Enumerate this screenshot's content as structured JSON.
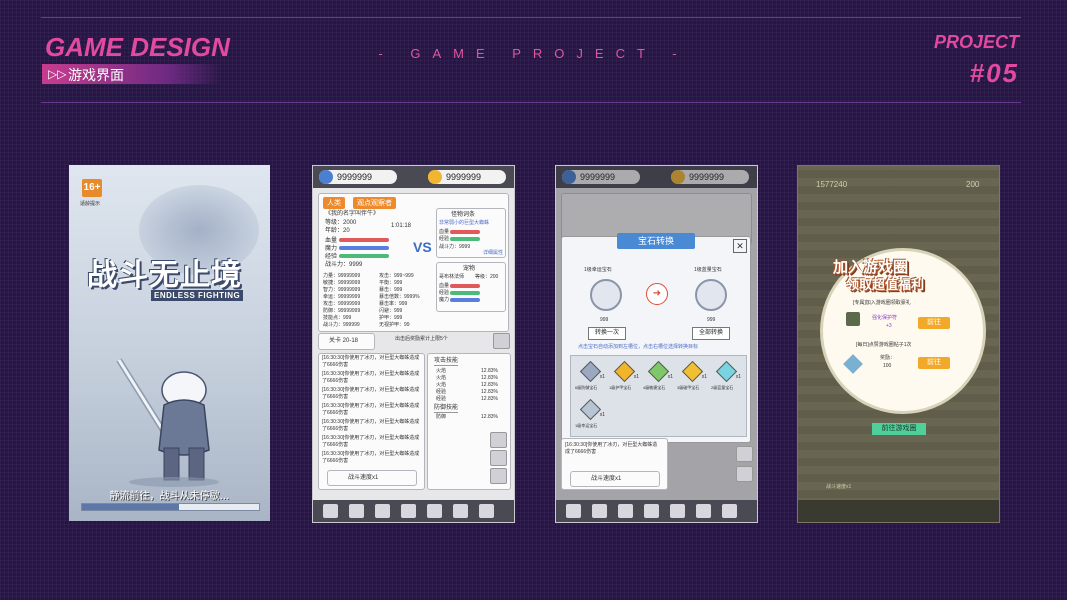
{
  "header": {
    "title": "GAME DESIGN",
    "subtitle": "游戏界面",
    "center_label": "- GAME PROJECT -",
    "project_label": "PROJECT",
    "project_number": "#05"
  },
  "screen1": {
    "age_rating": "16+",
    "age_text": "适龄提示",
    "logo_cn": "战斗无止境",
    "logo_en": "ENDLESS FIGHTING",
    "loading_text": "静流前往，战斗从未停歇…",
    "progress": 0.55
  },
  "screen2": {
    "currency1": "9999999",
    "currency2": "9999999",
    "tab_race": "人类",
    "tab_observer": "观点观察者",
    "player_name": "《我的名字叫伴牛》",
    "level_label": "等级：2000",
    "age_label": "年龄：20",
    "timer": "1:01:18",
    "stat_hp": "血量",
    "stat_mp": "魔力",
    "stat_exp": "经验",
    "combat_label": "战斗力：9999",
    "vs": "VS",
    "monster_title": "怪物词条",
    "monster_name": "非常弱小的巨型大蜘蛛",
    "detail_link": "详细属性",
    "pet_title": "宠物",
    "pet_name": "哥布林法师",
    "pet_level": "等级：200",
    "attrs_left": [
      "力量：99999999",
      "敏捷：99999999",
      "智力：99999999",
      "幸运：99999999",
      "攻击：99999999",
      "防御：99999999",
      "技能点：999",
      "战斗力：999999"
    ],
    "attrs_right": [
      "攻击：999~999",
      "平衡：999",
      "暴击：999",
      "暴击倍数：9999%",
      "暴击率：999",
      "闪避：999",
      "护甲：999",
      "无视护甲：99"
    ],
    "stage": "关卡 20-18",
    "stage_note": "出击后奖励累计上限5个",
    "logs": [
      "[16:30:30]你使用了冰刃，对巨型大蜘蛛造成了6666伤害",
      "[16:30:30]你使用了冰刃，对巨型大蜘蛛造成了6666伤害",
      "[16:30:30]你使用了冰刃，对巨型大蜘蛛造成了6666伤害",
      "[16:30:30]你使用了冰刃，对巨型大蜘蛛造成了6666伤害",
      "[16:30:30]你使用了冰刃，对巨型大蜘蛛造成了6666伤害",
      "[16:30:30]你使用了冰刃，对巨型大蜘蛛造成了6666伤害",
      "[16:30:30]你使用了冰刃，对巨型大蜘蛛造成了6666伤害"
    ],
    "attack_skill": "攻击技能",
    "attack_rows": [
      [
        "火焰",
        "12.83%"
      ],
      [
        "火焰",
        "12.83%"
      ],
      [
        "火焰",
        "12.83%"
      ],
      [
        "经验",
        "12.83%"
      ],
      [
        "经验",
        "12.83%"
      ]
    ],
    "defense_skill": "防御技能",
    "defense_rows": [
      [
        "防御",
        "12.83%"
      ]
    ],
    "speed": "战斗速度x1"
  },
  "screen3": {
    "currency1": "9999999",
    "currency2": "9999999",
    "modal_title": "宝石转换",
    "left_gem": "1级幸运宝石",
    "right_gem": "1级蓝量宝石",
    "cost": "999",
    "convert_one": "转换一次",
    "convert_all": "全部转换",
    "hint": "点击宝石自动添加到左槽位，点击右槽位选择转换目标",
    "gems": [
      {
        "name": "6级防御宝石",
        "count": "x1",
        "color": "#9aa8c0"
      },
      {
        "name": "1级护甲宝石",
        "count": "x1",
        "color": "#f1b52c"
      },
      {
        "name": "4级敏捷宝石",
        "count": "x1",
        "color": "#7ec86a"
      },
      {
        "name": "3级破甲宝石",
        "count": "x1",
        "color": "#f0c030"
      },
      {
        "name": "2级蓝量宝石",
        "count": "x1",
        "color": "#7ad4e0"
      },
      {
        "name": "1级幸运宝石",
        "count": "x1",
        "color": "#b6c4d4"
      }
    ],
    "log": "[16:30:30]你使用了冰刃，对巨型大蜘蛛造成了6666伤害",
    "speed": "战斗速度x1"
  },
  "screen4": {
    "currency1": "1577240",
    "currency2": "200",
    "banner_line1": "加入游戏圈",
    "banner_line2": "领取超值福利",
    "task1": "[专属]加入游戏圈领取豪礼",
    "reward1_name": "强化保护符",
    "reward1_qty": "+3",
    "go1": "前往",
    "task2": "[每日]点赞游戏圈帖子1次",
    "reward2_label": "奖励：",
    "reward2_qty": "100",
    "go2": "前往",
    "go_circle": "前往游戏圈",
    "speed": "战斗速度x1"
  },
  "colors": {
    "accent": "#e24a9f",
    "background": "#261545"
  }
}
